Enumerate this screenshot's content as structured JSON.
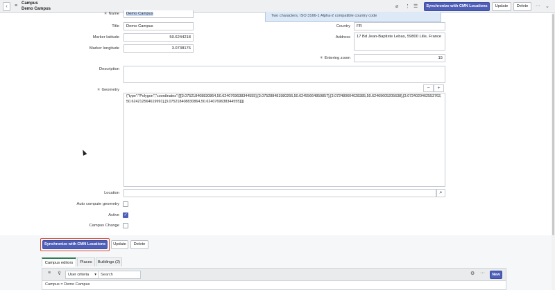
{
  "header": {
    "table_label": "Campus",
    "record_name": "Demo Campus",
    "sync_label": "Synchronize with CMN Locations",
    "update_label": "Update",
    "delete_label": "Delete"
  },
  "form": {
    "name": {
      "label": "Name",
      "value": "Demo Campus"
    },
    "country_hint": "Two characters, ISO 3166-1 Alpha-2 compatible country code",
    "title": {
      "label": "Title",
      "value": "Demo Campus"
    },
    "country": {
      "label": "Country",
      "value": "FR"
    },
    "marker_latitude": {
      "label": "Marker latitude",
      "value": "50.6244218"
    },
    "address": {
      "label": "Address",
      "value": "17 Bd Jean-Baptiste Lebas, 59800 Lille, France"
    },
    "marker_longitude": {
      "label": "Marker longitude",
      "value": "3.0738176"
    },
    "entering_zoom": {
      "label": "Entering zoom",
      "value": "15"
    },
    "description": {
      "label": "Description",
      "value": ""
    },
    "geometry": {
      "label": "Geometry",
      "value": "{\"type\":\"Polygon\",\"coordinates\":[[[3.075218408830864,50.6240769638344555],[3.075288481980266,50.62455664859857],[3.072480604028385,50.62469605205638],[3.0724020462553762,50.624212564619991],[3.075218408830864,50.6240769638344555]]]}"
    },
    "location": {
      "label": "Location",
      "value": ""
    },
    "auto_compute": {
      "label": "Auto compute geometry",
      "checked": false
    },
    "active": {
      "label": "Active",
      "checked": true
    },
    "campus_change": {
      "label": "Campus Change",
      "checked": false
    }
  },
  "footer": {
    "sync_label": "Synchronize with CMN Locations",
    "update_label": "Update",
    "delete_label": "Delete"
  },
  "related": {
    "tabs": [
      "Campus editors",
      "Places",
      "Buildings (2)"
    ],
    "filter_select": "User criteria",
    "search_placeholder": "Search",
    "new_label": "New",
    "breadcrumb": "Campus = Demo Campus"
  },
  "colors": {
    "primary": "#4f5fb8",
    "highlight": "#d24b3a",
    "active_tab": "#2e7d57"
  }
}
